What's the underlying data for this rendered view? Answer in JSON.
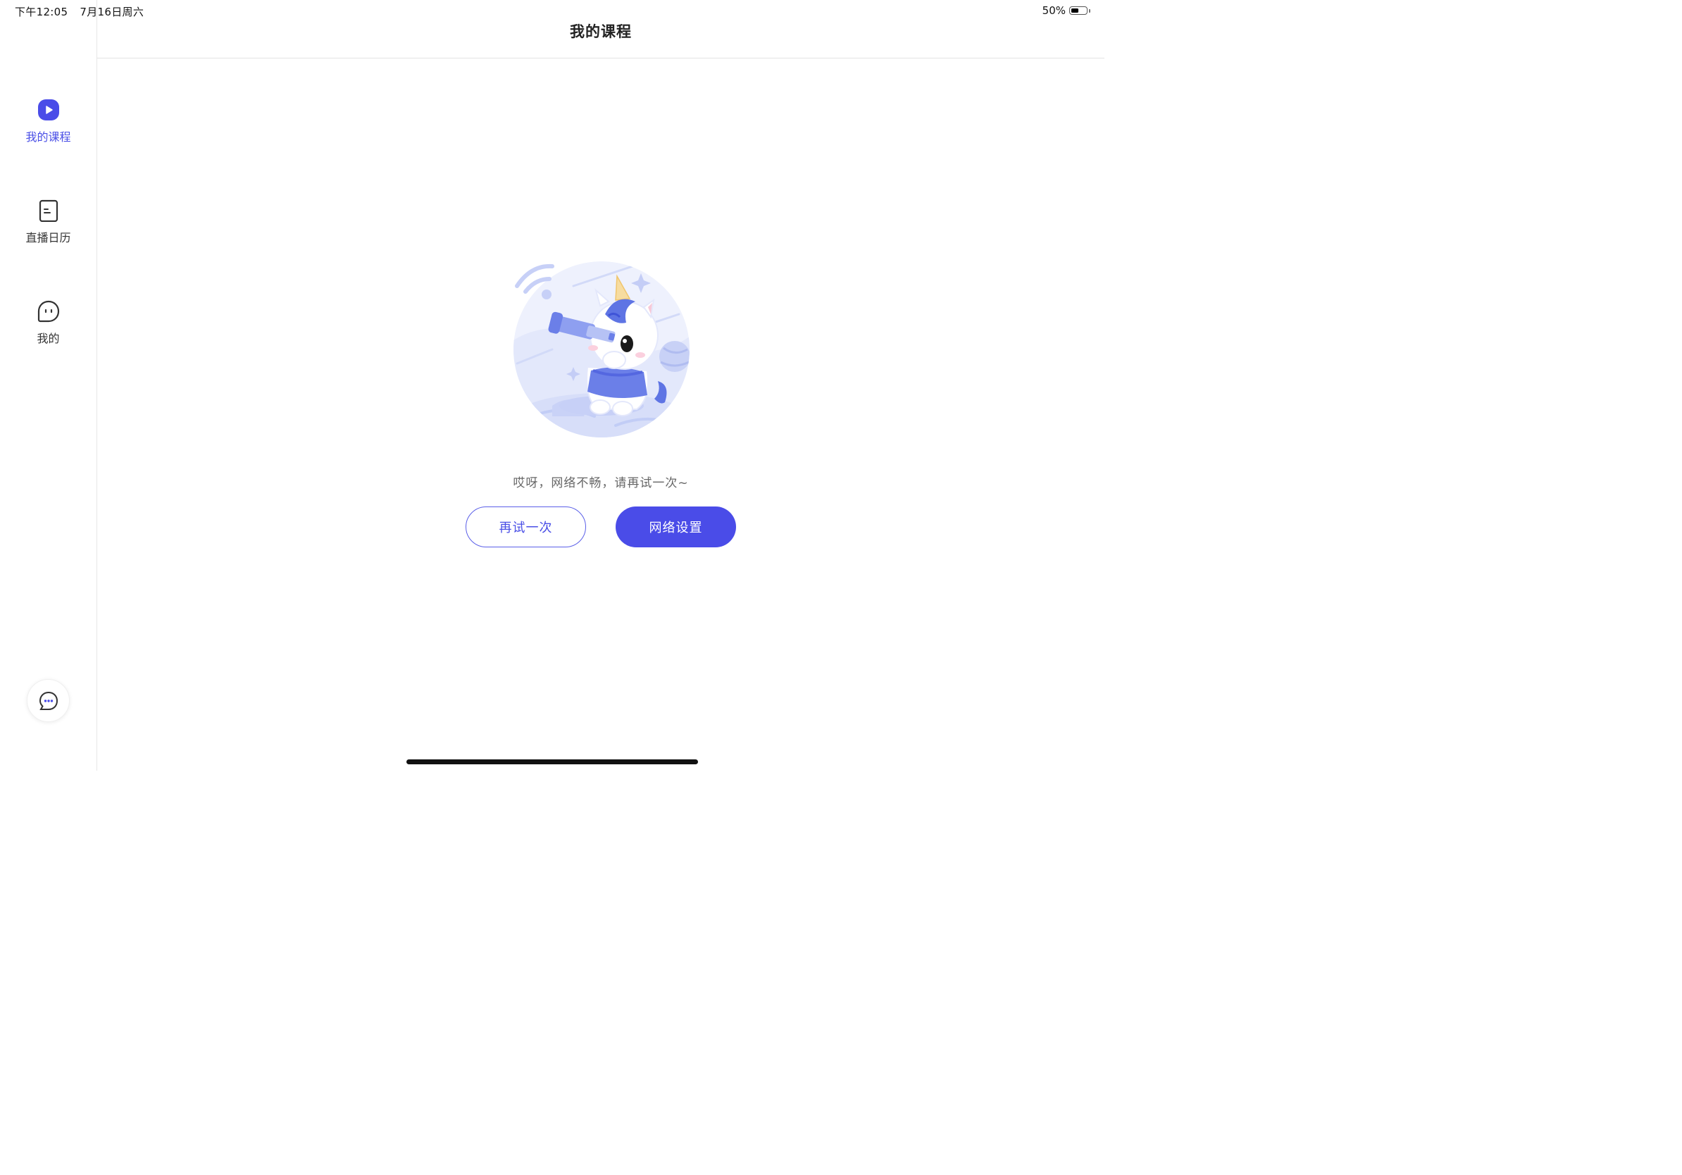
{
  "status_bar": {
    "time": "下午12:05",
    "date": "7月16日周六",
    "battery_percent": "50%",
    "battery_level": 0.5
  },
  "sidebar": {
    "items": [
      {
        "label": "我的课程",
        "icon": "play-icon",
        "active": true
      },
      {
        "label": "直播日历",
        "icon": "calendar-doc-icon",
        "active": false
      },
      {
        "label": "我的",
        "icon": "profile-face-icon",
        "active": false
      }
    ],
    "chat_button_icon": "chat-bubble-icon"
  },
  "header": {
    "title": "我的课程"
  },
  "empty_state": {
    "illustration": "unicorn-telescope-illustration",
    "message": "哎呀，网络不畅，请再试一次~",
    "retry_label": "再试一次",
    "settings_label": "网络设置"
  },
  "colors": {
    "accent": "#4a4ce8",
    "illustration_light": "#e8ecfc",
    "illustration_mid": "#a8b6f2",
    "illustration_dark": "#5e74e4"
  }
}
